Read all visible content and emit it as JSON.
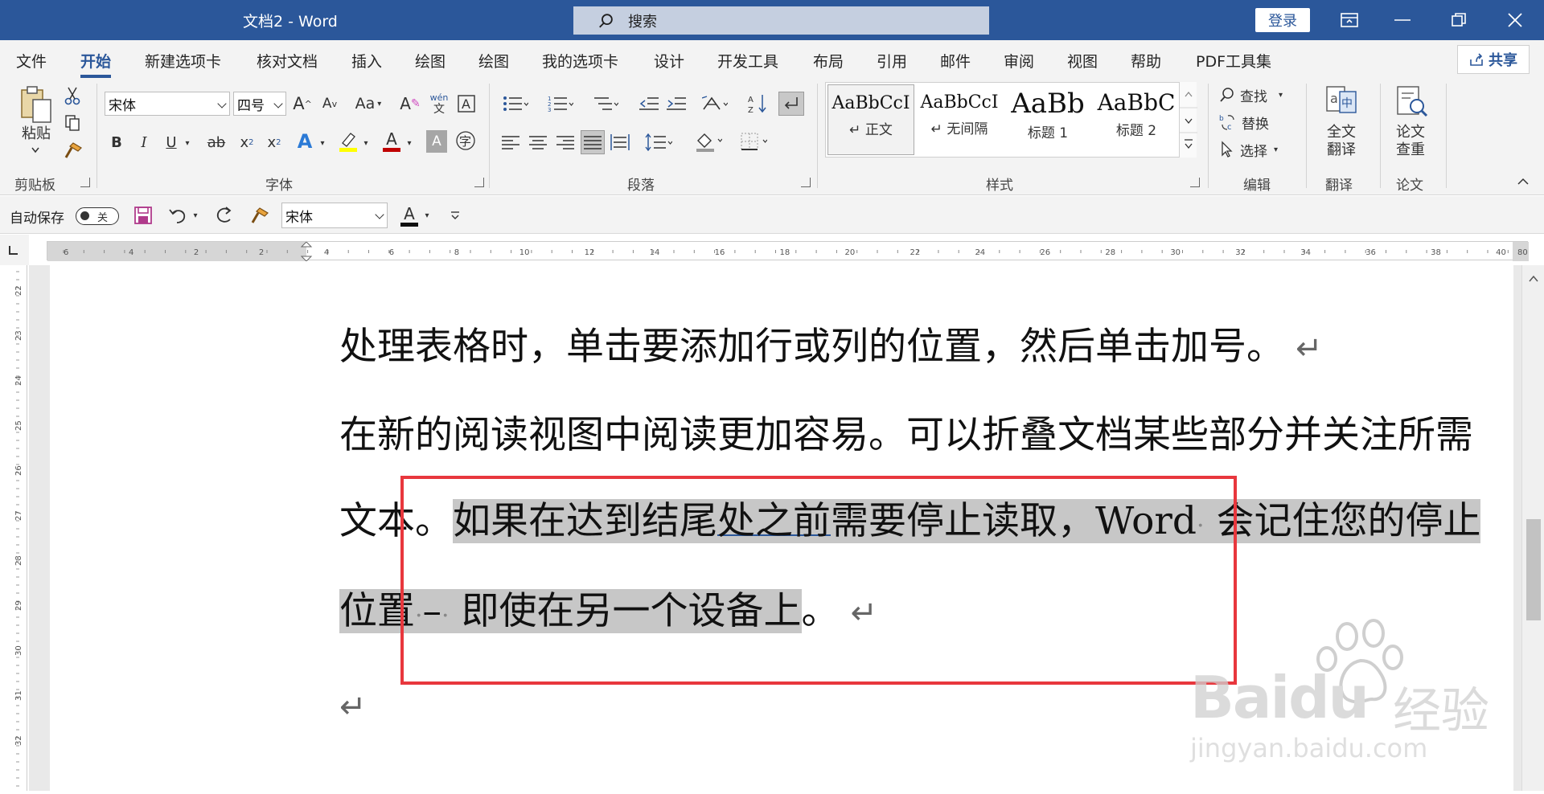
{
  "titlebar": {
    "title": "文档2  -  Word",
    "search_placeholder": "搜索",
    "login": "登录"
  },
  "menu": {
    "tabs": [
      "文件",
      "开始",
      "新建选项卡",
      "核对文档",
      "插入",
      "绘图",
      "绘图",
      "我的选项卡",
      "设计",
      "开发工具",
      "布局",
      "引用",
      "邮件",
      "审阅",
      "视图",
      "帮助",
      "PDF工具集"
    ],
    "active_index": 1,
    "share": "共享"
  },
  "ribbon": {
    "clipboard": {
      "paste": "粘贴",
      "label": "剪贴板"
    },
    "font": {
      "font_name": "宋体",
      "font_size": "四号",
      "grow": "A",
      "shrink": "A",
      "case": "Aa",
      "pinyin_top": "wén",
      "pinyin_bottom": "文",
      "bold": "B",
      "italic": "I",
      "underline": "U",
      "strike": "ab",
      "sub": "x",
      "sup": "x",
      "text_effect": "A",
      "font_color": "A",
      "char_shading": "A",
      "enclose": "字",
      "label": "字体"
    },
    "paragraph": {
      "label": "段落"
    },
    "styles": {
      "items": [
        {
          "sample": "AaBbCcI",
          "name": "↵ 正文"
        },
        {
          "sample": "AaBbCcI",
          "name": "↵ 无间隔"
        },
        {
          "sample": "AaBb",
          "name": "标题 1"
        },
        {
          "sample": "AaBbC",
          "name": "标题 2"
        }
      ],
      "label": "样式"
    },
    "editing": {
      "find": "查找",
      "replace": "替换",
      "select": "选择",
      "label": "编辑"
    },
    "translate": {
      "line1": "全文",
      "line2": "翻译",
      "label": "翻译"
    },
    "thesis": {
      "line1": "论文",
      "line2": "查重",
      "label": "论文"
    }
  },
  "qat": {
    "autosave": "自动保存",
    "toggle_state": "关",
    "font": "宋体",
    "font_color_letter": "A"
  },
  "ruler": {
    "numbers": [
      "6",
      "4",
      "2",
      "2",
      "4",
      "6",
      "8",
      "10",
      "12",
      "14",
      "16",
      "18",
      "20",
      "22",
      "24",
      "26",
      "28",
      "30",
      "32",
      "34",
      "36",
      "38",
      "40",
      "80"
    ],
    "v_numbers": [
      "22",
      "23",
      "24",
      "25",
      "26",
      "27",
      "28",
      "29",
      "30",
      "31",
      "32"
    ]
  },
  "document": {
    "line1": "处理表格时，单击要添加行或列的位置，然后单击加号。",
    "line2": "在新的阅读视图中阅读更加容易。可以折叠文档某些部分并关注所需",
    "line3_plain": "文本。",
    "line3_sel_a": "如果在达到结尾",
    "line3_sel_under": "处之前",
    "line3_sel_b": "需要停止读取，Word",
    "dot": "·",
    "line3_sel_c": "会记住您的停止",
    "line4_sel": "位置",
    "line4_sel_b": "–",
    "line4_sel_c": "即使在另一个设备上",
    "line4_plain": "。",
    "return_mark": "↵"
  },
  "watermark": {
    "brand": "Baidu",
    "cn": "经验",
    "url": "jingyan.baidu.com"
  },
  "colors": {
    "titlebar": "#2b579a",
    "selection": "#c7c7c7",
    "annotation": "#e8373d"
  }
}
